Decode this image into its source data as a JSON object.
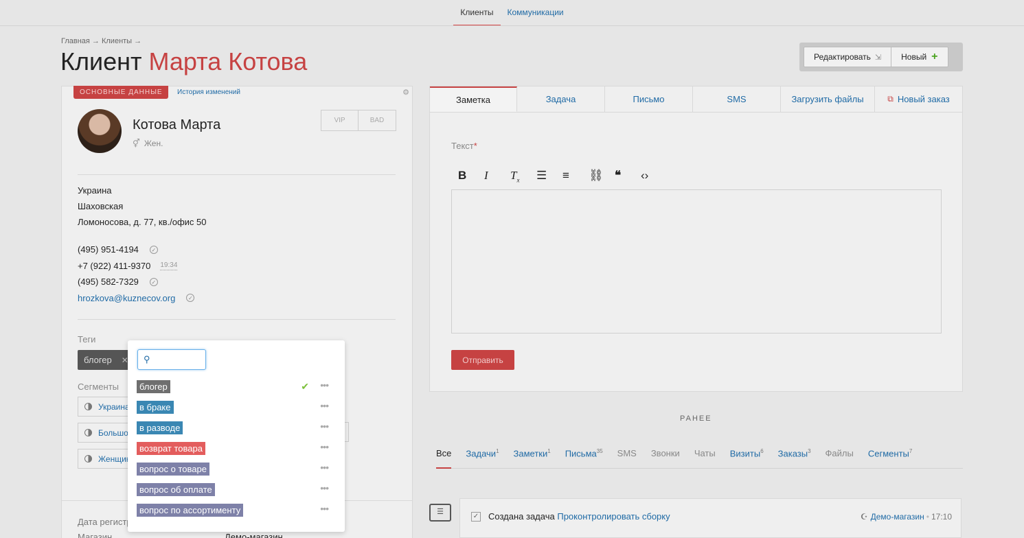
{
  "topnav": {
    "clients": "Клиенты",
    "communications": "Коммуникации"
  },
  "breadcrumb": "Главная → Клиенты →",
  "title": {
    "prefix": "Клиент",
    "name": "Марта Котова"
  },
  "actions": {
    "edit": "Редактировать",
    "new": "Новый"
  },
  "customer": {
    "section_label": "ОСНОВНЫЕ ДАННЫЕ",
    "history_link": "История изменений",
    "name": "Котова Марта",
    "gender": "Жен.",
    "vip": "VIP",
    "bad": "BAD",
    "address": {
      "country": "Украина",
      "city": "Шаховская",
      "street": "Ломоносова, д. 77, кв./офис 50"
    },
    "phones": [
      "(495) 951-4194",
      "+7 (922) 411-9370",
      "(495) 582-7329"
    ],
    "phone_time": "19:34",
    "email": "hrozkova@kuznecov.org",
    "tags_label": "Теги",
    "tag": "блогер",
    "segments_label": "Сегменты",
    "segments": [
      "Украина",
      "Большой",
      "Женщин"
    ],
    "segment_right_text": "н",
    "registered_label": "Дата регистр...",
    "shop_label": "Магазин",
    "registered_value": "??? ????",
    "shop_value": "Демо-магазин"
  },
  "tabs": [
    "Заметка",
    "Задача",
    "Письмо",
    "SMS",
    "Загрузить файлы",
    "Новый заказ"
  ],
  "note": {
    "text_label": "Текст",
    "required_mark": "*",
    "submit": "Отправить"
  },
  "toolbar_icons": [
    "bold-icon",
    "italic-icon",
    "clear-format-icon",
    "bullet-list-icon",
    "numbered-list-icon",
    "link-icon",
    "quote-icon",
    "code-icon"
  ],
  "earlier": "РАНЕЕ",
  "feed_tabs": [
    {
      "label": "Все",
      "count": ""
    },
    {
      "label": "Задачи",
      "count": "1"
    },
    {
      "label": "Заметки",
      "count": "1"
    },
    {
      "label": "Письма",
      "count": "35"
    },
    {
      "label": "SMS",
      "count": ""
    },
    {
      "label": "Звонки",
      "count": ""
    },
    {
      "label": "Чаты",
      "count": ""
    },
    {
      "label": "Визиты",
      "count": "6"
    },
    {
      "label": "Заказы",
      "count": "3"
    },
    {
      "label": "Файлы",
      "count": ""
    },
    {
      "label": "Сегменты",
      "count": "7"
    }
  ],
  "feed_item": {
    "text": "Создана задача",
    "link": "Проконтролировать сборку",
    "shop": "Демо-магазин",
    "time": "17:10"
  },
  "tag_dropdown": {
    "search_value": "",
    "items": [
      {
        "label": "блогер",
        "color": "#6f6f6f",
        "selected": true
      },
      {
        "label": "в браке",
        "color": "#3a87b3",
        "selected": false
      },
      {
        "label": "в разводе",
        "color": "#3a87b3",
        "selected": false
      },
      {
        "label": "возврат товара",
        "color": "#e35d5d",
        "selected": false
      },
      {
        "label": "вопрос о товаре",
        "color": "#7e81a8",
        "selected": false
      },
      {
        "label": "вопрос об оплате",
        "color": "#7e81a8",
        "selected": false
      },
      {
        "label": "вопрос по ассортименту",
        "color": "#7e81a8",
        "selected": false
      }
    ]
  },
  "colors": {
    "accent": "#c64242",
    "link": "#1f6aa5",
    "check": "#7cc03a"
  }
}
